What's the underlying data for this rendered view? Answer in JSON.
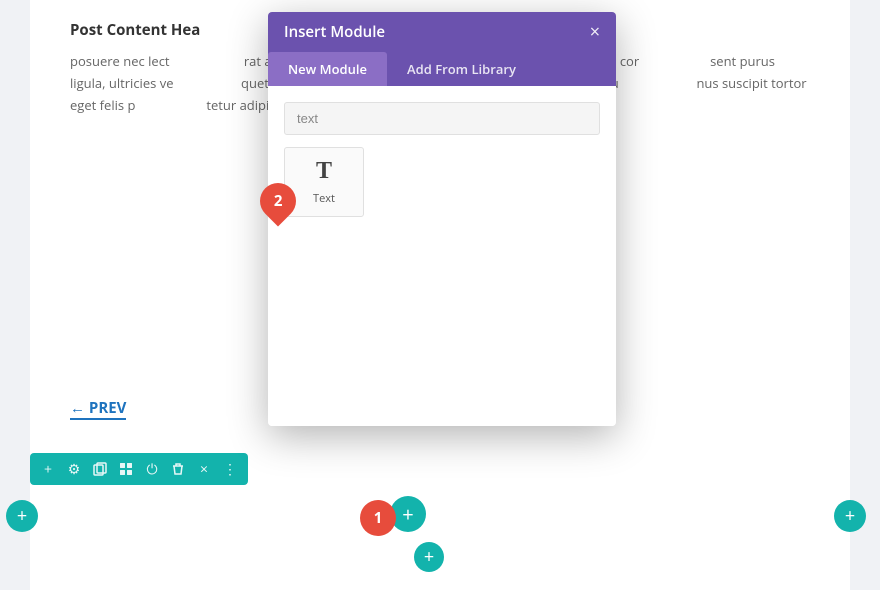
{
  "page": {
    "background_color": "#f0f2f5"
  },
  "content": {
    "heading": "Post Content Hea",
    "paragraphs": [
      "posuere nec lect                                          rat ac fermentum accu                                          Proin dictum auctor mi, eu cor                                          sent purus ligula, ultricies ve                                          quet, condimentum es                                          um finibus, lacus mauris pu                                          nus suscipit tortor eget felis p                                          tetur adipiscing elit."
    ]
  },
  "prev_link": {
    "label": "PREV",
    "arrow": "←"
  },
  "modal": {
    "title": "Insert Module",
    "close_label": "×",
    "tabs": [
      {
        "id": "new-module",
        "label": "New Module",
        "active": true
      },
      {
        "id": "add-from-library",
        "label": "Add From Library",
        "active": false
      }
    ],
    "search": {
      "placeholder": "text",
      "value": "text"
    },
    "modules": [
      {
        "id": "text",
        "label": "Text",
        "icon": "T"
      }
    ]
  },
  "toolbar": {
    "buttons": [
      "+",
      "⚙",
      "⊟",
      "⊞",
      "⏻",
      "🗑",
      "×",
      "⋮"
    ]
  },
  "badges": {
    "badge_1": "1",
    "badge_2": "2"
  },
  "plus_buttons": {
    "label": "+"
  }
}
